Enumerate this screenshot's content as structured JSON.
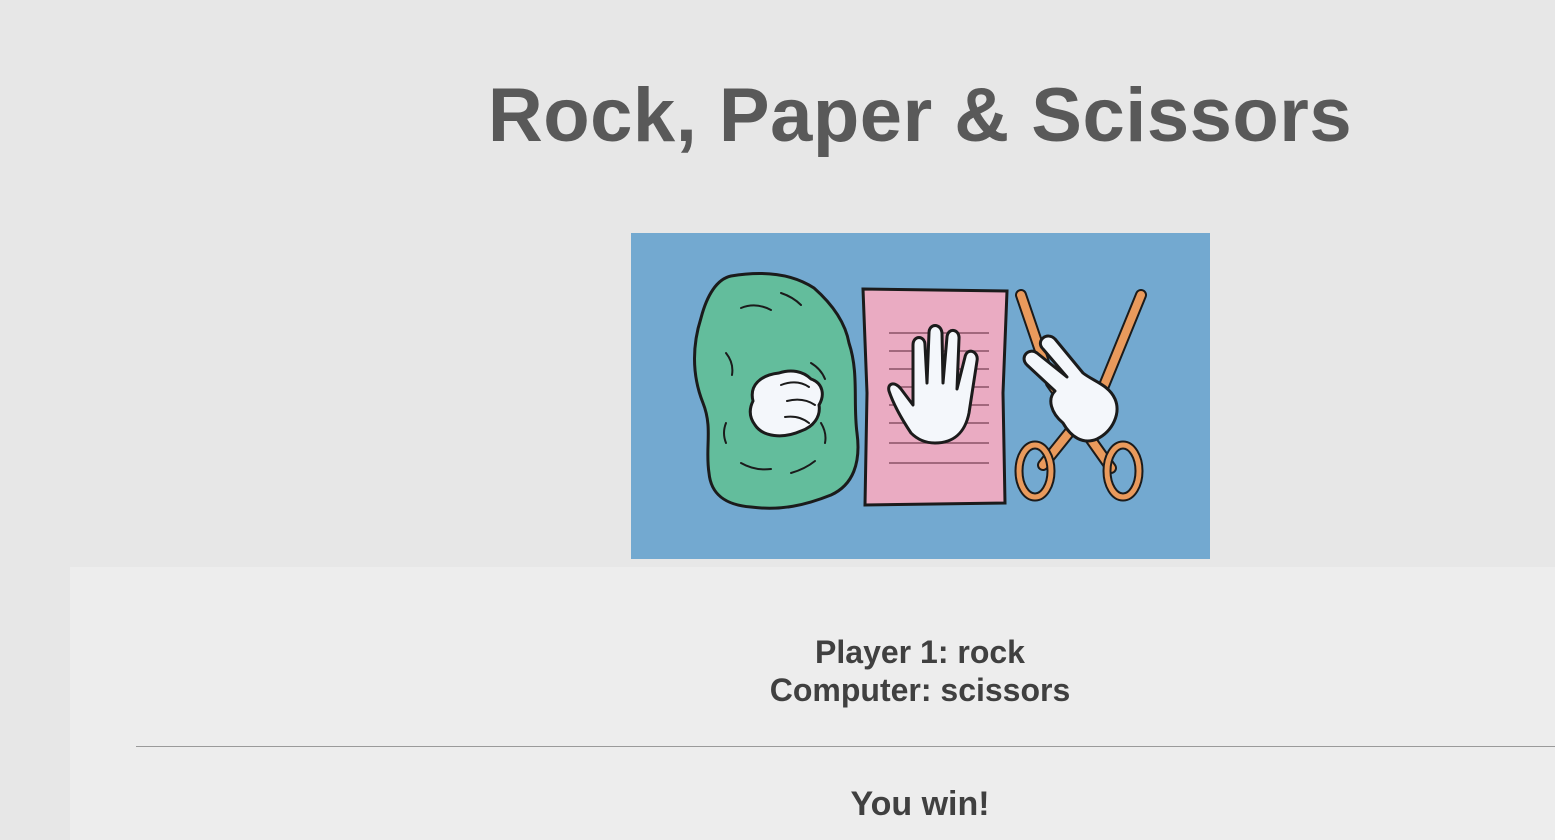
{
  "header": {
    "title": "Rock, Paper & Scissors"
  },
  "hero_image": {
    "icons": [
      "rock-icon",
      "paper-icon",
      "scissors-icon"
    ],
    "background_color": "#73a9d0"
  },
  "game": {
    "player_line": "Player 1: rock",
    "computer_line": "Computer: scissors",
    "result": "You win!"
  },
  "colors": {
    "page_background": "#e7e7e7",
    "panel_background": "#ededed",
    "title_color": "#595959",
    "text_color": "#404040",
    "rock_color": "#63bd9c",
    "paper_color": "#eaabc2",
    "scissors_color": "#e99a5c"
  }
}
